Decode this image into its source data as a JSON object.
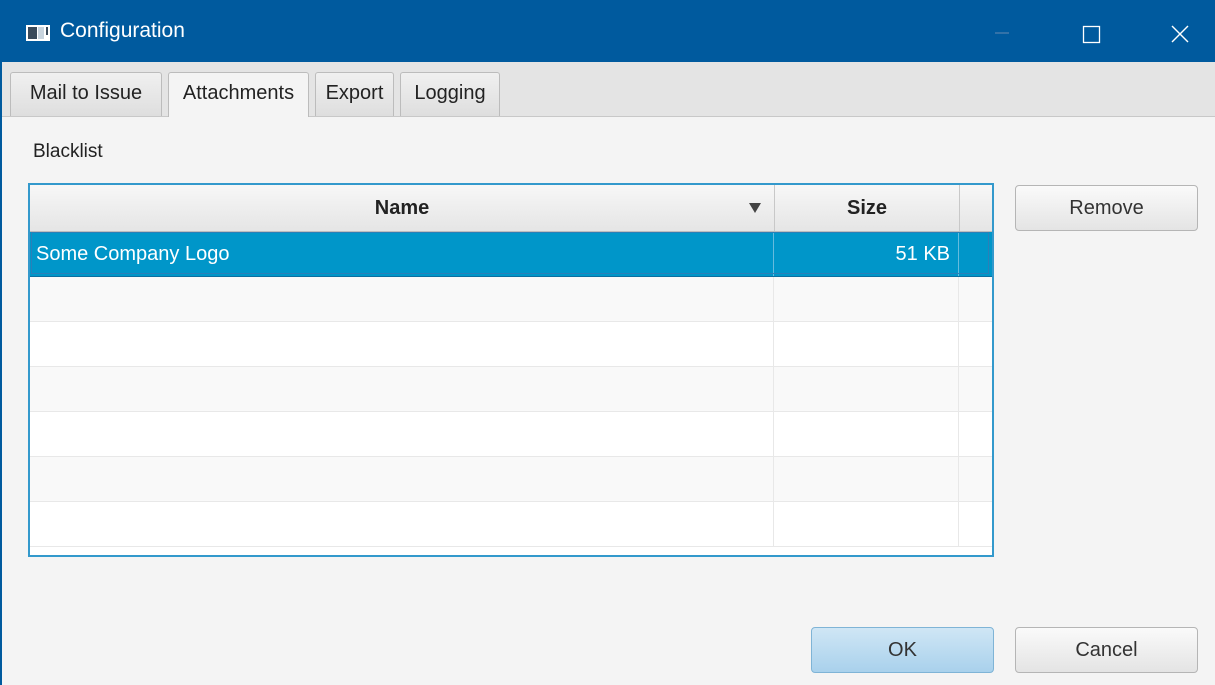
{
  "window": {
    "title": "Configuration",
    "accent": "#005a9e"
  },
  "tabs": [
    {
      "label": "Mail to Issue",
      "active": false
    },
    {
      "label": "Attachments",
      "active": true
    },
    {
      "label": "Export",
      "active": false
    },
    {
      "label": "Logging",
      "active": false
    }
  ],
  "section": {
    "label": "Blacklist"
  },
  "table": {
    "columns": {
      "name": "Name",
      "size": "Size"
    },
    "sort": {
      "column": "Name",
      "direction": "descending"
    },
    "rows": [
      {
        "name": "Some Company Logo",
        "size": "51 KB",
        "selected": true
      }
    ],
    "selection_color": "#0096c9"
  },
  "buttons": {
    "remove": "Remove",
    "ok": "OK",
    "cancel": "Cancel"
  },
  "icons": {
    "app": "app-window-icon",
    "minimize": "minimize-icon",
    "maximize": "maximize-icon",
    "close": "close-icon",
    "sort": "sort-down-arrow-icon"
  }
}
